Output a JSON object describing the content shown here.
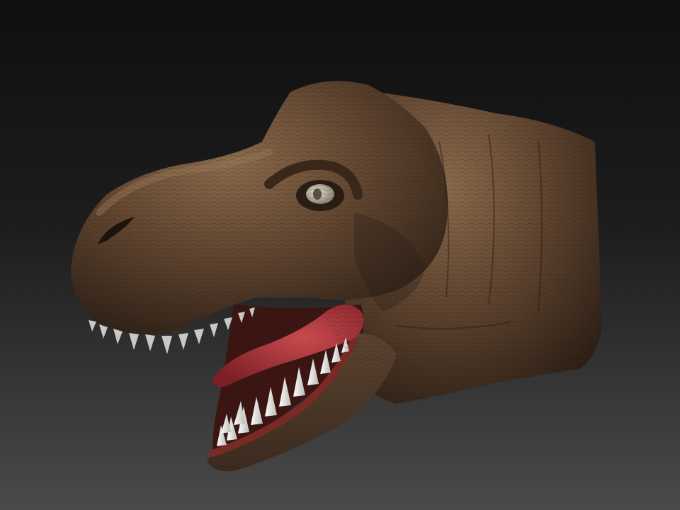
{
  "scene": {
    "subject": "dinosaur-head",
    "background_gradient": [
      "#0f0f0f",
      "#1f1f1f",
      "#4a4a4a"
    ],
    "colors": {
      "skin_highlight": "#8a6a4c",
      "skin_base": "#5e4431",
      "skin_shadow": "#2a1d14",
      "tongue": "#a8323a",
      "gum": "#7a2a24",
      "tooth": "#e4e4e0",
      "eye": "#cfc8b8"
    }
  }
}
